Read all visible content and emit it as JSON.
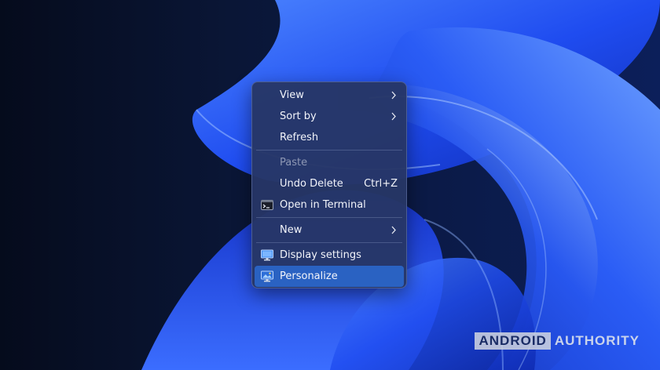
{
  "context_menu": {
    "items": [
      {
        "label": "View",
        "submenu": true
      },
      {
        "label": "Sort by",
        "submenu": true
      },
      {
        "label": "Refresh"
      },
      {
        "label": "Paste",
        "disabled": true
      },
      {
        "label": "Undo Delete",
        "shortcut": "Ctrl+Z"
      },
      {
        "label": "Open in Terminal",
        "icon": "terminal-icon"
      },
      {
        "label": "New",
        "submenu": true
      },
      {
        "label": "Display settings",
        "icon": "display-icon"
      },
      {
        "label": "Personalize",
        "icon": "personalize-icon",
        "selected": true
      }
    ]
  },
  "watermark": {
    "brand_first": "ANDROID",
    "brand_second": "AUTHORITY"
  },
  "colors": {
    "accent": "#2a62c2",
    "menu_bg": "#263666",
    "wallpaper_blue": "#1f4cf0"
  }
}
